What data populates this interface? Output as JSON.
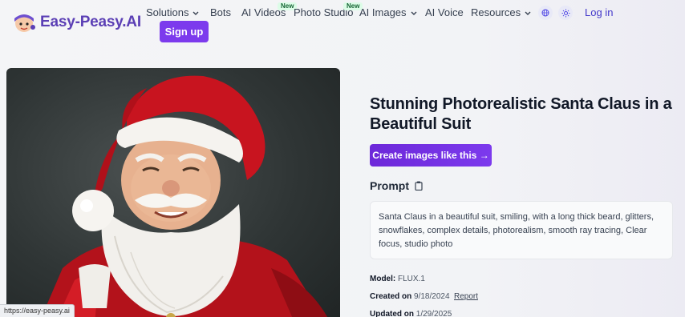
{
  "brand": {
    "name": "Easy-Peasy.AI",
    "color": "#5b3fb5"
  },
  "nav": {
    "items": [
      {
        "label": "Solutions",
        "has_dropdown": true
      },
      {
        "label": "Bots"
      },
      {
        "label": "AI Videos",
        "badge": "New"
      },
      {
        "label": "Photo Studio",
        "badge": "New"
      },
      {
        "label": "AI Images",
        "has_dropdown": true
      },
      {
        "label": "AI Voice"
      },
      {
        "label": "Resources",
        "has_dropdown": true
      }
    ],
    "login_label": "Log in",
    "signup_label": "Sign up",
    "icons": [
      "globe-icon",
      "sun-icon"
    ]
  },
  "main": {
    "title": "Stunning Photorealistic Santa Claus in a Beautiful Suit",
    "cta_label": "Create images like this →",
    "prompt_heading": "Prompt",
    "prompt_text": "Santa Claus in a beautiful suit, smiling, with a long thick beard, glitters, snowflakes, complex details, photorealism, smooth ray tracing, Clear focus, studio photo",
    "meta": {
      "model_label": "Model:",
      "model_value": "FLUX.1",
      "created_label": "Created on",
      "created_value": "9/18/2024",
      "report_label": "Report",
      "updated_label": "Updated on",
      "updated_value": "1/29/2025"
    },
    "image_subject": "santa-claus-photo"
  },
  "status_bar": {
    "url": "https://easy-peasy.ai"
  },
  "colors": {
    "accent": "#7c3aed",
    "link": "#4338ca"
  }
}
